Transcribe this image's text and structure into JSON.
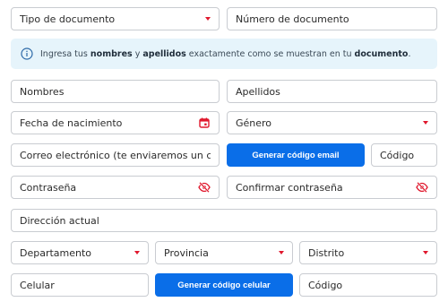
{
  "form": {
    "tipo_documento": "Tipo de documento",
    "numero_documento": "Número de documento",
    "notice": {
      "pre": "Ingresa tus ",
      "nombres": "nombres",
      "mid1": " y ",
      "apellidos": "apellidos",
      "mid2": " exactamente como se muestran en tu ",
      "documento": "documento",
      "end": "."
    },
    "nombres": "Nombres",
    "apellidos": "Apellidos",
    "fecha_nacimiento": "Fecha de nacimiento",
    "genero": "Género",
    "correo": "Correo electrónico (te enviaremos un código)",
    "generar_email": "Generar código email",
    "codigo_email": "Código",
    "contrasena": "Contraseña",
    "confirmar_contrasena": "Confirmar contraseña",
    "direccion": "Dirección actual",
    "departamento": "Departamento",
    "provincia": "Provincia",
    "distrito": "Distrito",
    "celular": "Celular",
    "generar_celular": "Generar código celular",
    "codigo_celular": "Código"
  },
  "colors": {
    "accent_blue": "#0a6ee8",
    "caret_red": "#e0182d",
    "notice_bg": "#e6f4fb"
  },
  "icons": {
    "calendar": "calendar-icon",
    "eye_off": "eye-off-icon",
    "info": "info-icon",
    "caret": "caret-down-icon"
  }
}
